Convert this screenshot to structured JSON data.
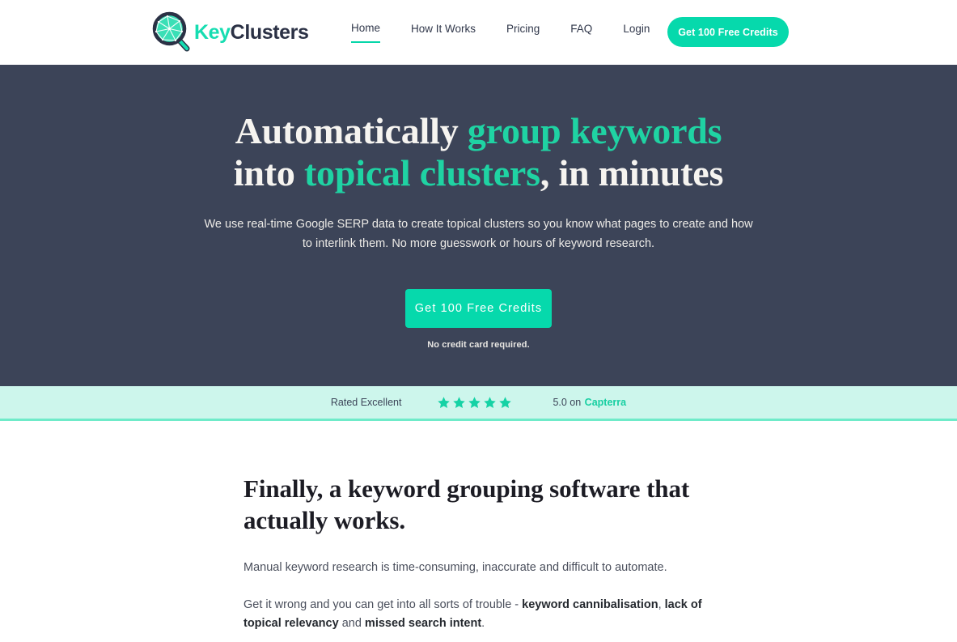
{
  "brand": {
    "logo_icon": "magnifying-glass-cluster-icon",
    "name_part1": "Key",
    "name_part2": "Clusters"
  },
  "nav": {
    "items": [
      {
        "label": "Home",
        "active": true
      },
      {
        "label": "How It Works",
        "active": false
      },
      {
        "label": "Pricing",
        "active": false
      },
      {
        "label": "FAQ",
        "active": false
      },
      {
        "label": "Login",
        "active": false
      }
    ],
    "cta_label": "Get 100 Free Credits"
  },
  "hero": {
    "title_line1_plain": "Automatically ",
    "title_line1_highlight": "group keywords",
    "title_line2_plain_pre": "into ",
    "title_line2_highlight": "topical clusters",
    "title_line2_plain_post": ", in minutes",
    "subtitle": "We use real-time Google SERP data to create topical clusters so you know what pages to create and how to interlink them. No more guesswork or hours of keyword research.",
    "cta_label": "Get 100 Free Credits",
    "note": "No credit card required."
  },
  "rating": {
    "label": "Rated Excellent",
    "star_icon": "star-icon",
    "stars_filled": 5,
    "score_text": "5.0 on",
    "source": "Capterra"
  },
  "section": {
    "title": "Finally, a keyword grouping software that actually works.",
    "paragraph1": "Manual keyword research is time-consuming, inaccurate and difficult to automate.",
    "paragraph2_pre": "Get it wrong and you can get into all sorts of trouble - ",
    "paragraph2_b1": "keyword cannibalisation",
    "paragraph2_mid1": ", ",
    "paragraph2_b2": "lack of topical relevancy",
    "paragraph2_mid2": " and ",
    "paragraph2_b3": "missed search intent",
    "paragraph2_end": "."
  },
  "colors": {
    "accent_teal": "#06D9AC",
    "hero_bg": "#3C4458",
    "mint_bg": "#CDF6EC",
    "mint_border": "#6FEBC9",
    "heading_highlight": "#1FD3A3",
    "brand_dark": "#2B3145"
  }
}
